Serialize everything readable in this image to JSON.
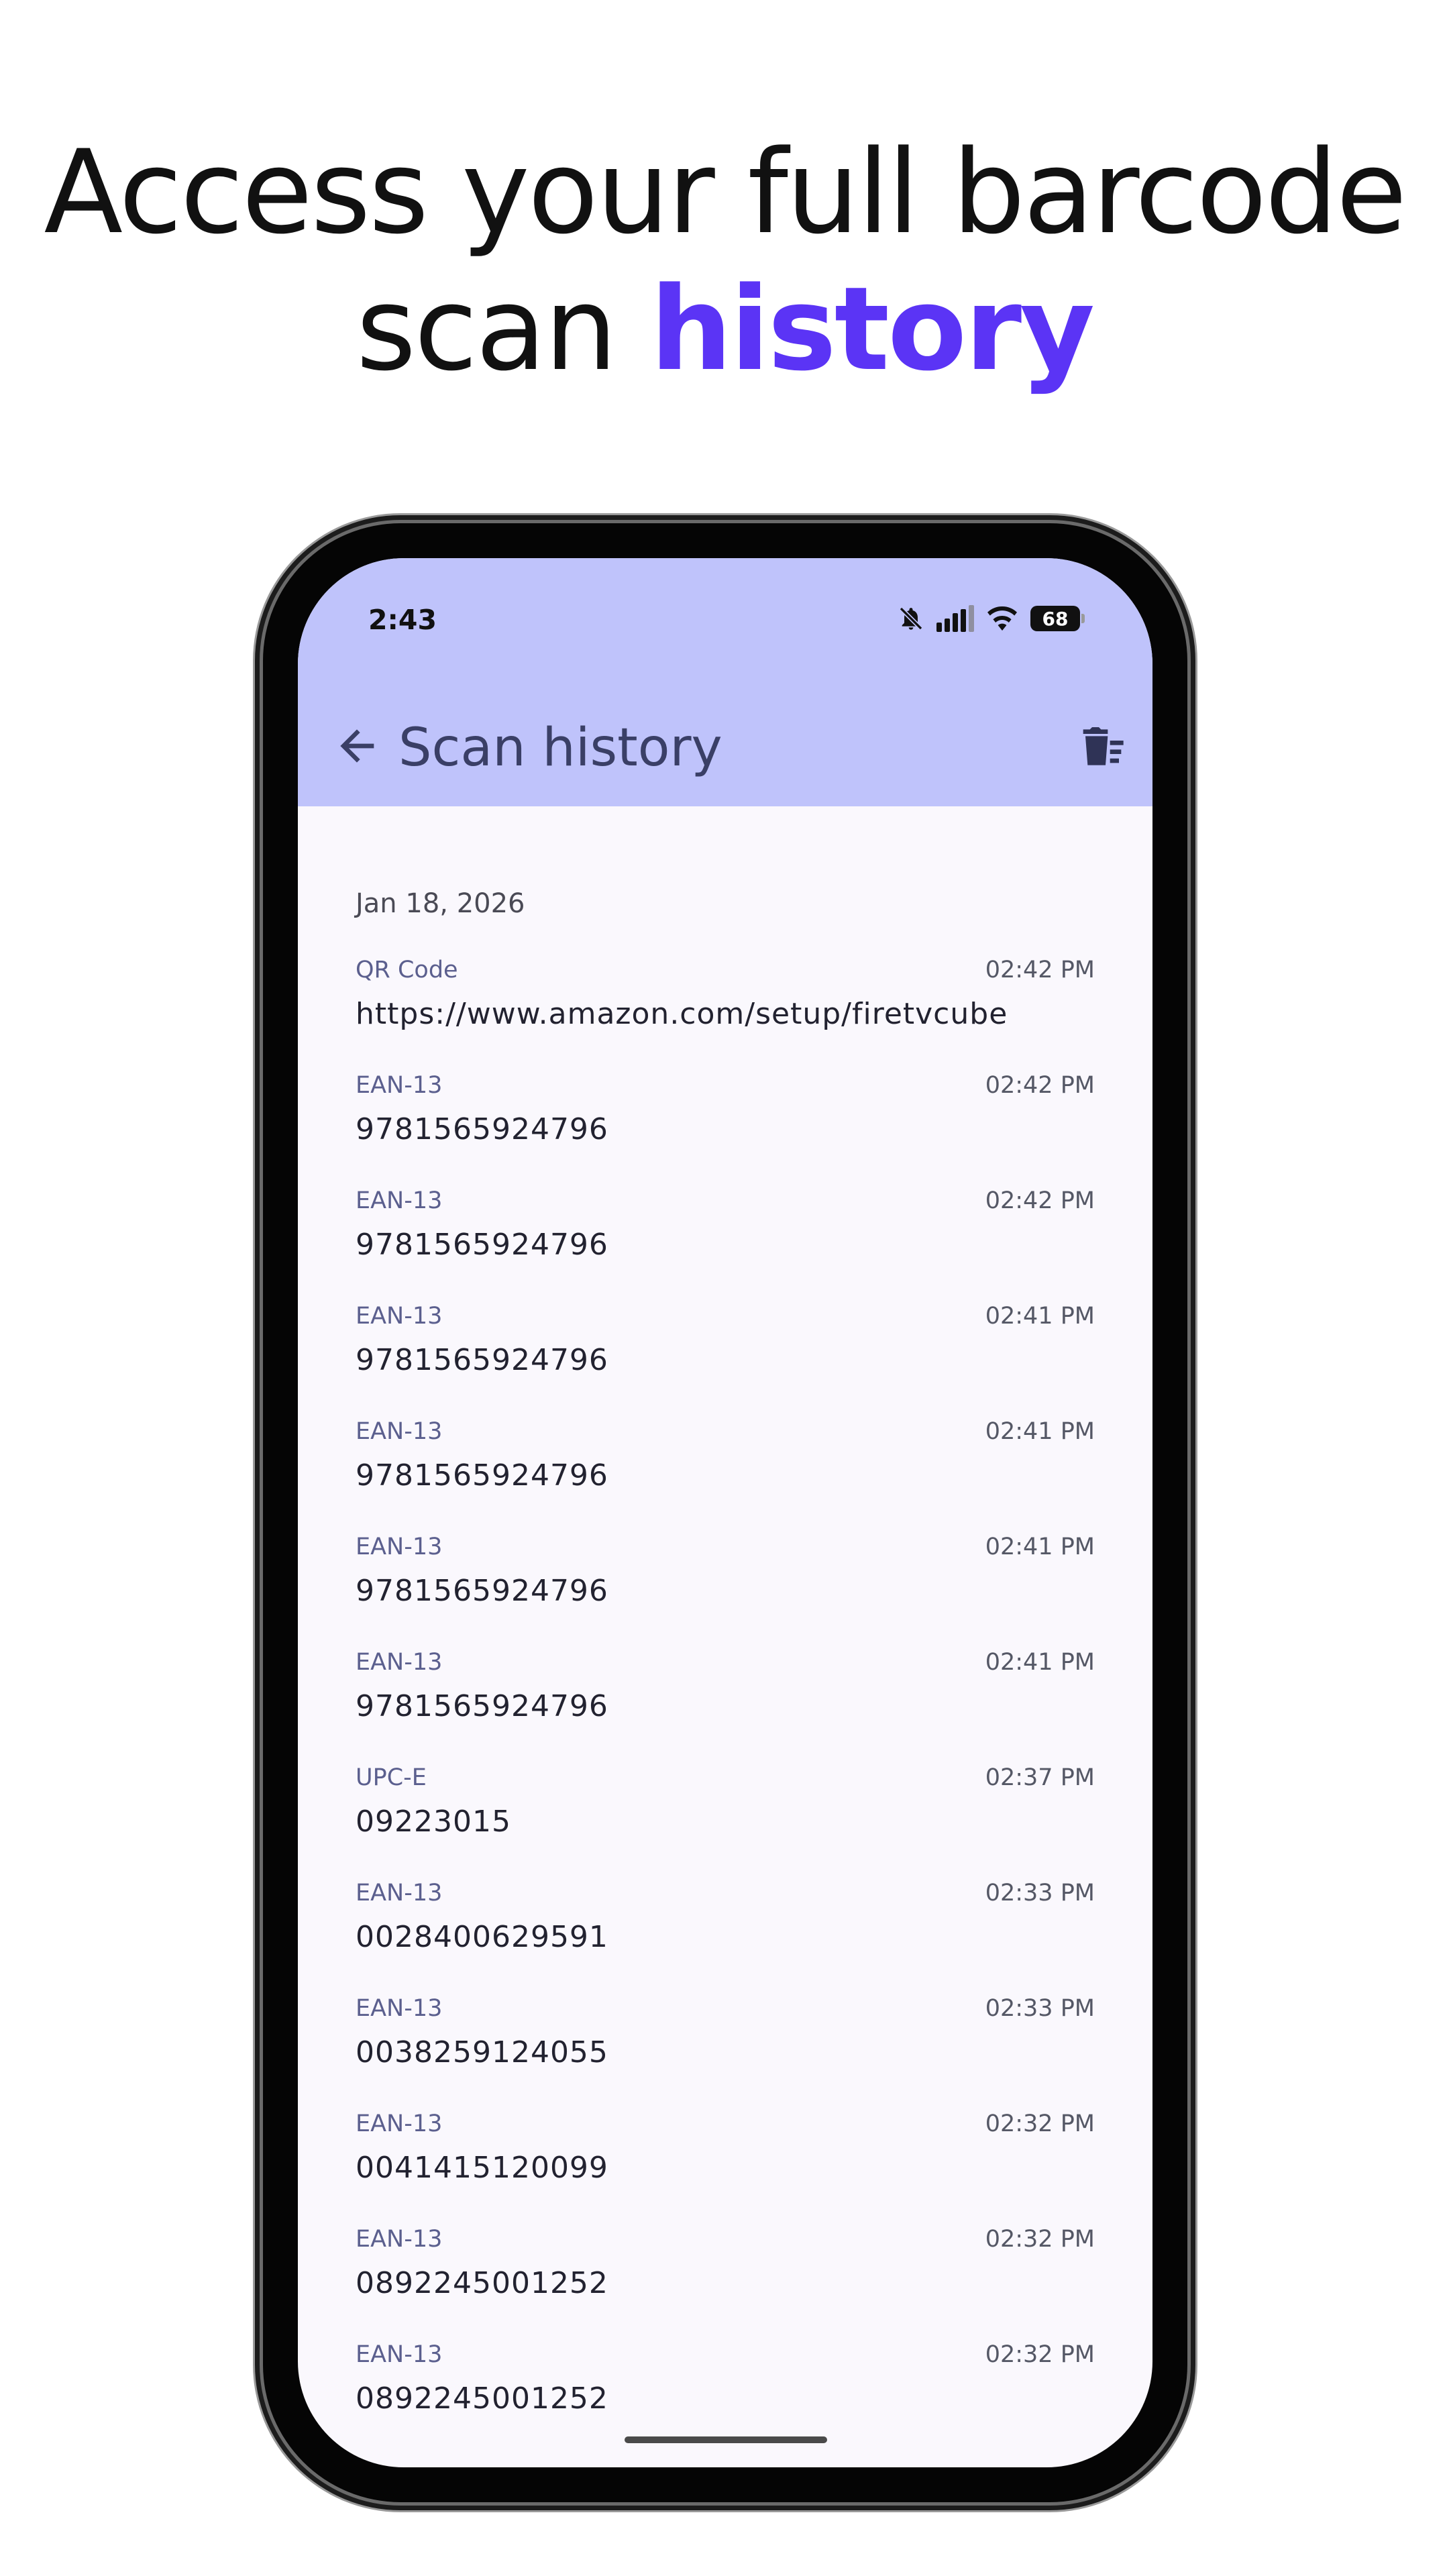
{
  "headline": {
    "line1": "Access your full barcode",
    "line2_plain": "scan ",
    "line2_accent": "history"
  },
  "colors": {
    "accent": "#5b34f5",
    "app_bar": "#bfc3fb",
    "background": "#faf8fd"
  },
  "status_bar": {
    "time": "2:43",
    "battery": "68",
    "icons": [
      "muted-bell-icon",
      "signal-icon",
      "wifi-icon",
      "battery-icon"
    ]
  },
  "app_bar": {
    "title": "Scan history",
    "back_icon": "arrow-back-icon",
    "delete_icon": "delete-history-icon"
  },
  "history": {
    "date_header": "Jan 18, 2026",
    "items": [
      {
        "type": "QR Code",
        "time": "02:42 PM",
        "value": "https://www.amazon.com/setup/firetvcube"
      },
      {
        "type": "EAN-13",
        "time": "02:42 PM",
        "value": "9781565924796"
      },
      {
        "type": "EAN-13",
        "time": "02:42 PM",
        "value": "9781565924796"
      },
      {
        "type": "EAN-13",
        "time": "02:41 PM",
        "value": "9781565924796"
      },
      {
        "type": "EAN-13",
        "time": "02:41 PM",
        "value": "9781565924796"
      },
      {
        "type": "EAN-13",
        "time": "02:41 PM",
        "value": "9781565924796"
      },
      {
        "type": "EAN-13",
        "time": "02:41 PM",
        "value": "9781565924796"
      },
      {
        "type": "UPC-E",
        "time": "02:37 PM",
        "value": "09223015"
      },
      {
        "type": "EAN-13",
        "time": "02:33 PM",
        "value": "0028400629591"
      },
      {
        "type": "EAN-13",
        "time": "02:33 PM",
        "value": "0038259124055"
      },
      {
        "type": "EAN-13",
        "time": "02:32 PM",
        "value": "0041415120099"
      },
      {
        "type": "EAN-13",
        "time": "02:32 PM",
        "value": "0892245001252"
      },
      {
        "type": "EAN-13",
        "time": "02:32 PM",
        "value": "0892245001252"
      }
    ]
  }
}
